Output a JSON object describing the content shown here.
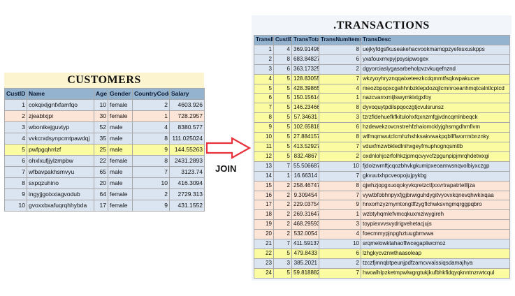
{
  "customers": {
    "title": "CUSTOMERS",
    "headers": [
      "CustID",
      "Name",
      "Age",
      "Gender",
      "CountryCode",
      "Salary"
    ],
    "rows": [
      {
        "id": "1",
        "name": "cokqixljgnfxfamfqo",
        "age": "10",
        "gender": "female",
        "country": "2",
        "salary": "4603.926",
        "color": "blue"
      },
      {
        "id": "2",
        "name": "zjeablxjpi",
        "age": "30",
        "gender": "female",
        "country": "1",
        "salary": "728.2957",
        "color": "peach"
      },
      {
        "id": "3",
        "name": "wbonikejguvtyp",
        "age": "52",
        "gender": "male",
        "country": "4",
        "salary": "8380.577",
        "color": "blue"
      },
      {
        "id": "4",
        "name": "vvkcrxdsynpcmtpawdqj",
        "age": "35",
        "gender": "male",
        "country": "8",
        "salary": "111.025024",
        "color": "blue"
      },
      {
        "id": "5",
        "name": "pwfpgqhrrlzf",
        "age": "25",
        "gender": "male",
        "country": "9",
        "salary": "144.55263",
        "color": "yellow"
      },
      {
        "id": "6",
        "name": "ohxlxufjjylzmpbw",
        "age": "22",
        "gender": "female",
        "country": "8",
        "salary": "2431.2893",
        "color": "blue"
      },
      {
        "id": "7",
        "name": "wfbavpakhsmvyu",
        "age": "65",
        "gender": "male",
        "country": "7",
        "salary": "3123.74",
        "color": "blue"
      },
      {
        "id": "8",
        "name": "sxpqzuhino",
        "age": "20",
        "gender": "male",
        "country": "10",
        "salary": "416.3094",
        "color": "blue"
      },
      {
        "id": "9",
        "name": "ingyjjgoixxiagvodub",
        "age": "64",
        "gender": "female",
        "country": "2",
        "salary": "2729.313",
        "color": "blue"
      },
      {
        "id": "10",
        "name": "gvoxxbxafuqrqhhybda",
        "age": "17",
        "gender": "female",
        "country": "9",
        "salary": "431.1552",
        "color": "blue"
      }
    ]
  },
  "join_label": "JOIN",
  "transactions": {
    "title": ".TRANSACTIONS",
    "headers": [
      "TransID",
      "CustID",
      "TransTotal",
      "TransNumItems",
      "TransDesc"
    ],
    "rows": [
      {
        "tid": "1",
        "cid": "4",
        "total": "369.91498",
        "items": "8",
        "desc": "uejkyfdgsfkuseakehacvookmamqpzyefesxuskpps",
        "color": "blue"
      },
      {
        "tid": "2",
        "cid": "8",
        "total": "683.84827",
        "items": "6",
        "desc": "yxafouxmvpyjpsysipwogex",
        "color": "blue"
      },
      {
        "tid": "3",
        "cid": "6",
        "total": "363.17325",
        "items": "2",
        "desc": "dgyorciaslygasarbeholpvzvkuqefnznd",
        "color": "blue"
      },
      {
        "tid": "4",
        "cid": "5",
        "total": "128.83055",
        "items": "7",
        "desc": "wkzyoyhryznqqaixeteezkcdqmmtfsqkwpakucve",
        "color": "yellow"
      },
      {
        "tid": "5",
        "cid": "5",
        "total": "428.39865",
        "items": "4",
        "desc": "meozbpopxcgahhnbzklepdozqjlcmnroeanhmqtcalntlcptcd",
        "color": "yellow"
      },
      {
        "tid": "6",
        "cid": "5",
        "total": "150.15614",
        "items": "1",
        "desc": "nazcvarrxmijlswymkixtgxfoy",
        "color": "yellow"
      },
      {
        "tid": "7",
        "cid": "5",
        "total": "146.23466",
        "items": "8",
        "desc": "dyvoquytpdilspqoczgtjcvulsrunsz",
        "color": "yellow"
      },
      {
        "tid": "8",
        "cid": "5",
        "total": "57.34631",
        "items": "3",
        "desc": "tzrzfldehuefkfkitulohxfqxnzmfgjvdncqmlnbeqck",
        "color": "yellow"
      },
      {
        "tid": "9",
        "cid": "5",
        "total": "102.65818",
        "items": "6",
        "desc": "hzdewekzovcnstrehfzhaiomcklyjghsmgdhmfivm",
        "color": "yellow"
      },
      {
        "tid": "10",
        "cid": "5",
        "total": "27.884157",
        "items": "8",
        "desc": "wlfmqmwutclcmhzhshksakvwakpqbllflworrmbnznky",
        "color": "yellow"
      },
      {
        "tid": "11",
        "cid": "5",
        "total": "413.52927",
        "items": "7",
        "desc": "vduxfmzwbkledlnihxgeyfmuphognqsmtlb",
        "color": "yellow"
      },
      {
        "tid": "12",
        "cid": "5",
        "total": "832.4867",
        "items": "2",
        "desc": "oxdnlohjozrfolhkzjpmqcvyvcfzpgunpipjmrqhdetwxgi",
        "color": "yellow"
      },
      {
        "tid": "13",
        "cid": "7",
        "total": "55.506687",
        "items": "10",
        "desc": "fjdoizwrnftjcqozbhvkgkumipxeoamwsnqvolbiyxczgp",
        "color": "blue"
      },
      {
        "tid": "14",
        "cid": "1",
        "total": "16.66314",
        "items": "7",
        "desc": "gkvuutxhpcveopojujpykbg",
        "color": "blue"
      },
      {
        "tid": "15",
        "cid": "2",
        "total": "258.46747",
        "items": "8",
        "desc": "qjwhzjopgxuoqokyvkqretzctljxxvrtrapatrtellljza",
        "color": "peach"
      },
      {
        "tid": "16",
        "cid": "2",
        "total": "9.309454",
        "items": "7",
        "desc": "vywtbfobhnpyxfjgjbrwiguhdygitvyovxkqnevqhwkixqaa",
        "color": "peach"
      },
      {
        "tid": "17",
        "cid": "2",
        "total": "229.03754",
        "items": "9",
        "desc": "hnxorhzyzmymtongtffzygflchwksvngmqrggpqbro",
        "color": "peach"
      },
      {
        "tid": "18",
        "cid": "2",
        "total": "269.31647",
        "items": "1",
        "desc": "wzbtyhqmlefvmcqkuxmziwygireh",
        "color": "peach"
      },
      {
        "tid": "19",
        "cid": "2",
        "total": "468.29593",
        "items": "3",
        "desc": "toypiexvvsvydrigvehetacjujs",
        "color": "peach"
      },
      {
        "tid": "20",
        "cid": "2",
        "total": "532.0054",
        "items": "4",
        "desc": "foecmmypjnpghztuugbmvwa",
        "color": "peach"
      },
      {
        "tid": "21",
        "cid": "7",
        "total": "411.59137",
        "items": "10",
        "desc": "srqmelowktahaoffwcegapliwcmoz",
        "color": "blue"
      },
      {
        "tid": "22",
        "cid": "5",
        "total": "479.8433",
        "items": "6",
        "desc": "lzhgkycvznwthaasoleap",
        "color": "yellow"
      },
      {
        "tid": "23",
        "cid": "3",
        "total": "385.2021",
        "items": "2",
        "desc": "tzczfjmnqbtpeunjpdfzamcvvalssiqsdamajhya",
        "color": "blue"
      },
      {
        "tid": "24",
        "cid": "5",
        "total": "59.818882",
        "items": "7",
        "desc": "hwoalhlpzketmpwlwgrgtukjkufbhkfidqyqknntnzrwtcqul",
        "color": "yellow"
      }
    ]
  },
  "colors": {
    "header": "#93b3cf",
    "blue_row": "#dbe5f1",
    "yellow_row": "#fbfba2",
    "peach_row": "#fce4d6",
    "arrow": "#e8313a"
  }
}
